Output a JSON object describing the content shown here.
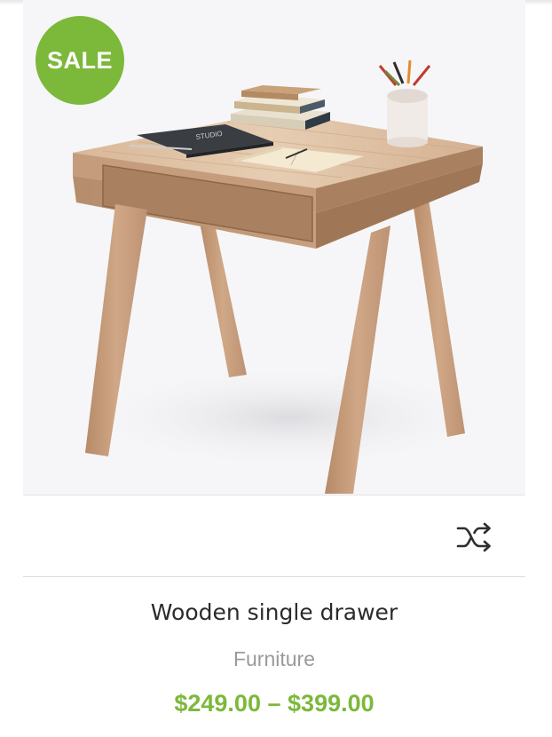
{
  "badge": {
    "label": "SALE"
  },
  "product": {
    "title": "Wooden single drawer",
    "category": "Furniture",
    "price_min": "$249.00",
    "price_separator": "–",
    "price_max": "$399.00"
  },
  "actions": {
    "compare_icon": "shuffle-compare-icon"
  },
  "colors": {
    "accent": "#7cb83a",
    "title": "#2b2b2b",
    "category": "#9a9a9a"
  }
}
